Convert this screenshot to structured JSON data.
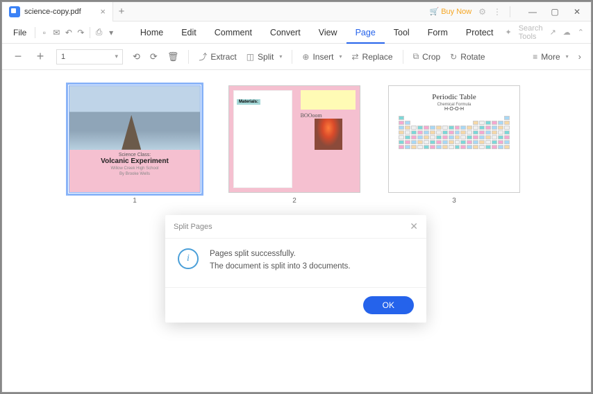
{
  "tab": {
    "filename": "science-copy.pdf"
  },
  "titlebar": {
    "buynow": "Buy Now"
  },
  "menubar": {
    "file": "File",
    "items": [
      "Home",
      "Edit",
      "Comment",
      "Convert",
      "View",
      "Page",
      "Tool",
      "Form",
      "Protect"
    ],
    "active_index": 5,
    "search_placeholder": "Search Tools"
  },
  "toolbar": {
    "page_value": "1",
    "extract": "Extract",
    "split": "Split",
    "insert": "Insert",
    "replace": "Replace",
    "crop": "Crop",
    "rotate": "Rotate",
    "more": "More"
  },
  "thumbs": {
    "p1": {
      "num": "1",
      "line1": "Science Class:",
      "line2": "Volcanic Experiment",
      "line3": "Willow Creek High School",
      "line4": "By Brooke Wells"
    },
    "p2": {
      "num": "2",
      "materials": "Materials:",
      "boom": "BOOoom"
    },
    "p3": {
      "num": "3",
      "title": "Periodic Table",
      "sub": "Chemical Formula",
      "formula": "H-O-O-H"
    }
  },
  "dialog": {
    "title": "Split Pages",
    "line1": "Pages split successfully.",
    "line2": "The document is split into 3 documents.",
    "ok": "OK"
  }
}
